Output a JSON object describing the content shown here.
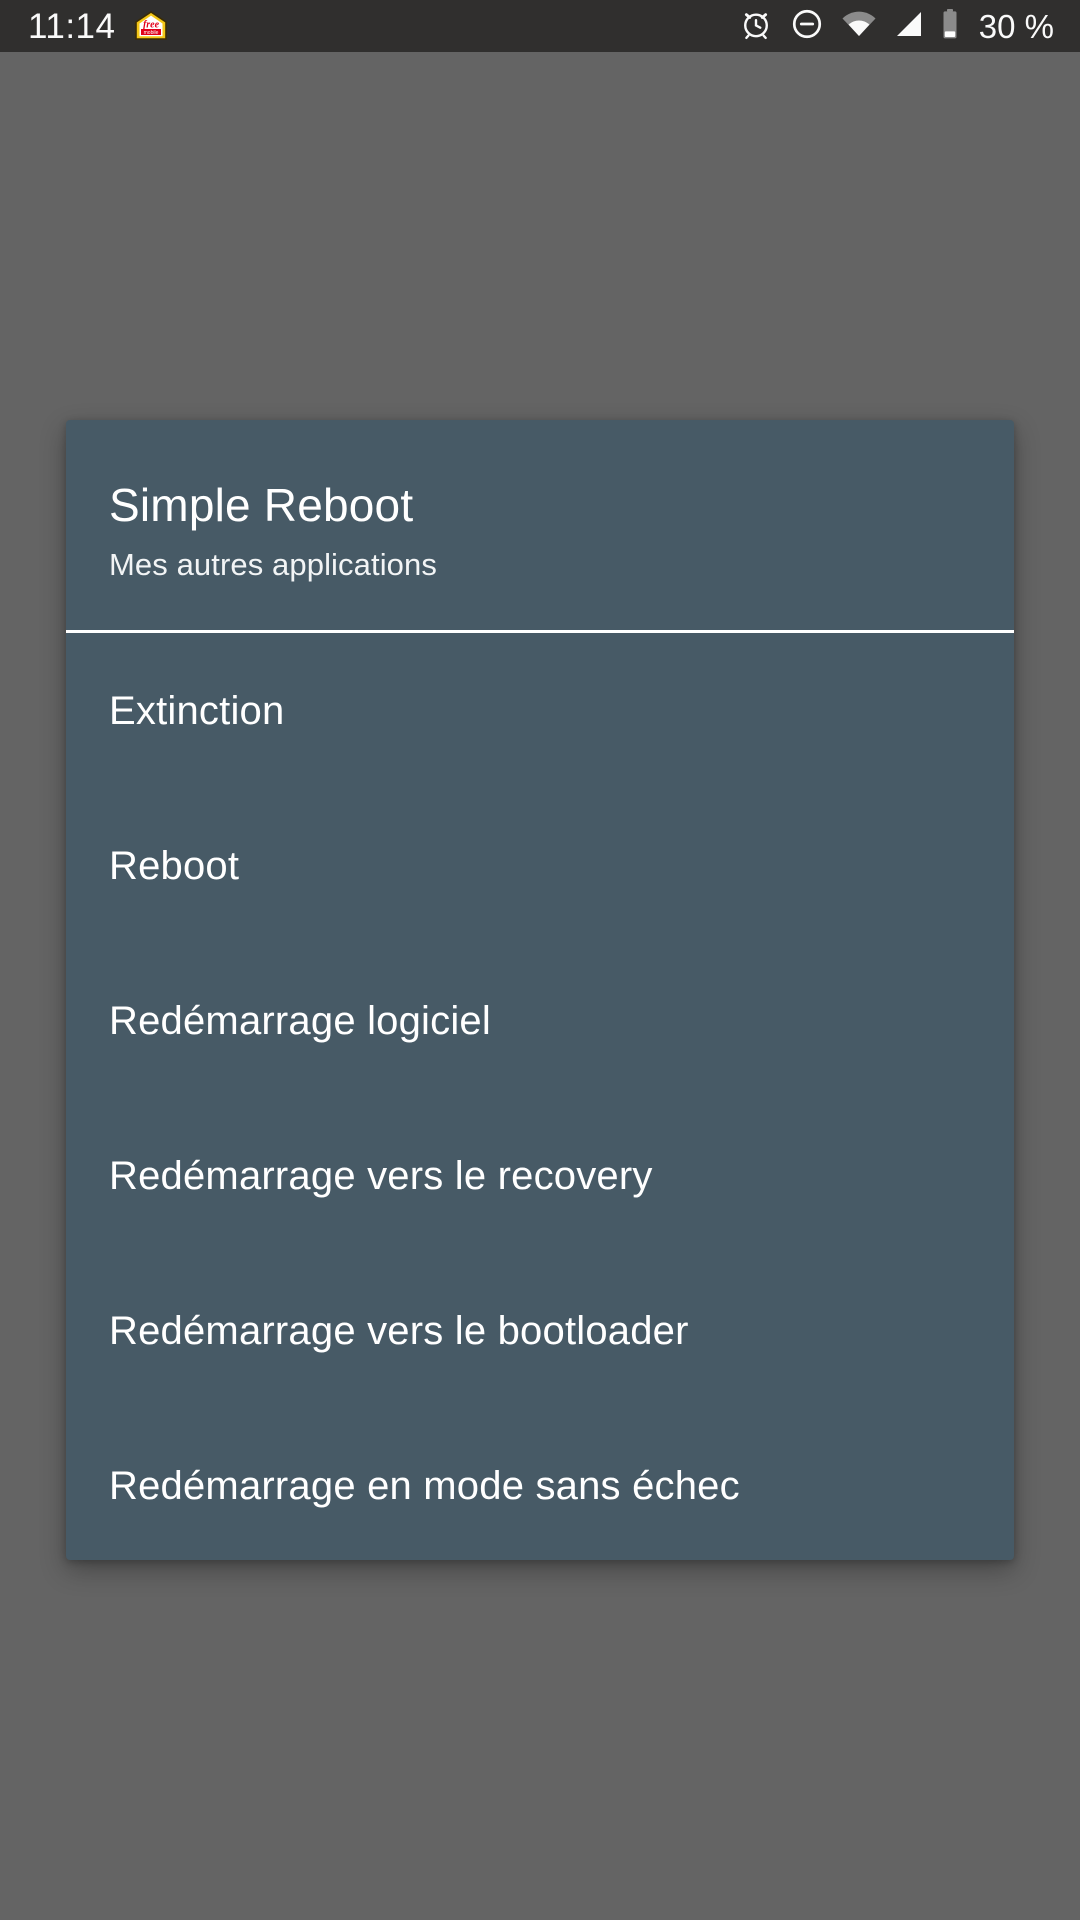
{
  "status_bar": {
    "time": "11:14",
    "carrier_logo": "free-mobile-logo",
    "battery_percent": "30 %",
    "icons": [
      {
        "name": "alarm-icon"
      },
      {
        "name": "do-not-disturb-icon"
      },
      {
        "name": "wifi-icon"
      },
      {
        "name": "cellular-signal-icon"
      },
      {
        "name": "battery-icon"
      }
    ]
  },
  "dialog": {
    "title": "Simple Reboot",
    "subtitle": "Mes autres applications",
    "items": [
      {
        "label": "Extinction"
      },
      {
        "label": "Reboot"
      },
      {
        "label": "Redémarrage logiciel"
      },
      {
        "label": "Redémarrage vers le recovery"
      },
      {
        "label": "Redémarrage vers le bootloader"
      },
      {
        "label": "Redémarrage en mode sans échec"
      }
    ]
  },
  "colors": {
    "status_bar_bg": "#302f2e",
    "backdrop": "#646464",
    "dialog_bg": "#475a66",
    "text": "#ffffff",
    "divider": "#ffffff"
  }
}
